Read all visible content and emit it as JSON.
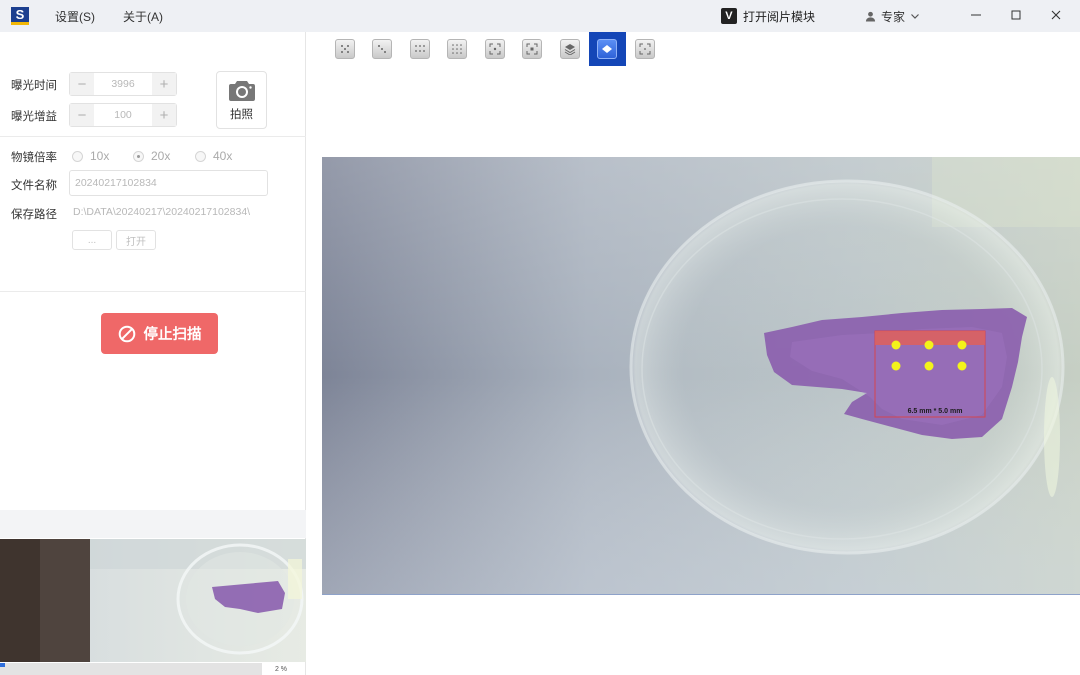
{
  "titlebar": {
    "app_logo_letter": "S",
    "menu": [
      "设置(S)",
      "关于(A)"
    ],
    "reader_logo_letter": "V",
    "reader_label": "打开阅片模块",
    "user_label": "专家",
    "icons": [
      "user-icon",
      "chevron-down-icon",
      "minimize-icon",
      "maximize-icon",
      "close-icon"
    ]
  },
  "camera": {
    "exposure_time_label": "曝光时间",
    "exposure_time_value": "3996",
    "exposure_gain_label": "曝光增益",
    "exposure_gain_value": "100",
    "photo_label": "拍照"
  },
  "settings": {
    "objective_label": "物镜倍率",
    "objective_options": [
      "10x",
      "20x",
      "40x"
    ],
    "objective_selected": "20x",
    "filename_label": "文件名称",
    "filename_value": "20240217102834",
    "save_path_label": "保存路径",
    "save_path_value": "D:\\DATA\\20240217\\20240217102834\\",
    "browse_label": "...",
    "open_label": "打开"
  },
  "actions": {
    "stop_scan_label": "停止扫描"
  },
  "progress": {
    "percent_text": "2 %",
    "value": 0.02
  },
  "toolbar": {
    "tools": [
      "scan-4x4-icon",
      "scan-2x2-icon",
      "scan-3x3-icon",
      "scan-grid-icon",
      "focus-point-icon",
      "focus-frame-icon",
      "layers-icon",
      "single-layer-icon",
      "center-focus-icon"
    ],
    "active_index": 7
  },
  "main_view": {
    "scan_region_label": "6.5 mm * 5.0 mm",
    "colors": {
      "tissue": "#8b5fae",
      "scan_region_border": "#d4454f",
      "focus_point": "#f3f31a",
      "accent": "#1446b7",
      "stop_button": "#ef6868"
    }
  }
}
